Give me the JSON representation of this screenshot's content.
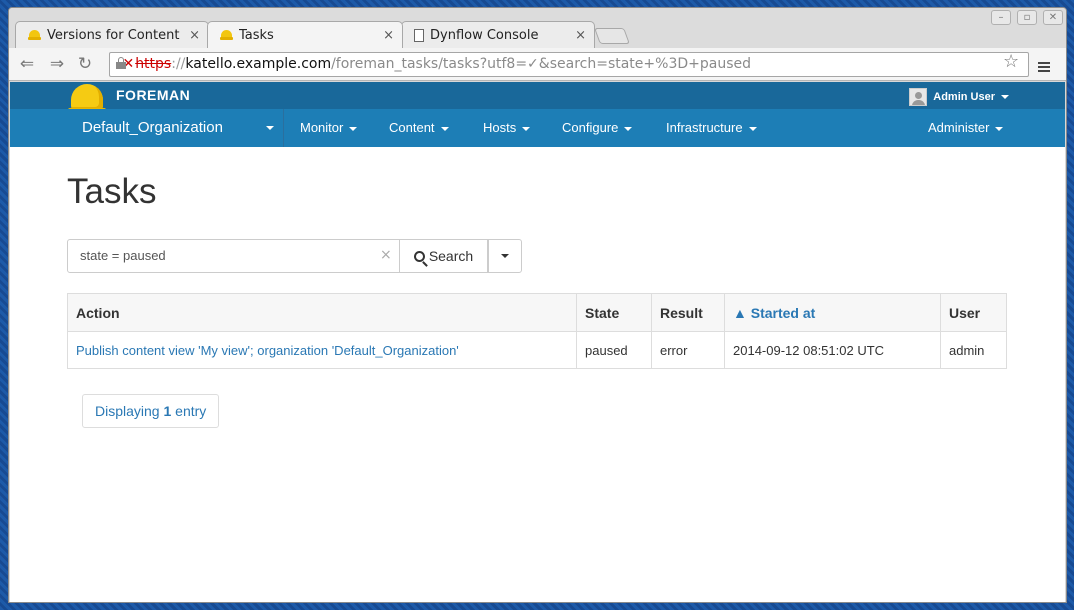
{
  "browser": {
    "tabs": [
      {
        "title": "Versions for Content V",
        "icon": "foreman-hat-icon"
      },
      {
        "title": "Tasks",
        "icon": "foreman-hat-icon"
      },
      {
        "title": "Dynflow Console",
        "icon": "page-icon"
      }
    ],
    "close_glyph": "×",
    "url": {
      "x_mark": "✕",
      "scheme": "https",
      "separator": "://",
      "host": "katello.example.com",
      "path": "/foreman_tasks/tasks?utf8=✓&search=state+%3D+paused"
    }
  },
  "header": {
    "brand": "FOREMAN",
    "user": "Admin User",
    "organization": "Default_Organization",
    "nav": {
      "monitor": "Monitor",
      "content": "Content",
      "hosts": "Hosts",
      "configure": "Configure",
      "infrastructure": "Infrastructure",
      "administer": "Administer"
    }
  },
  "main": {
    "title": "Tasks",
    "search": {
      "value": "state = paused",
      "clear": "×",
      "button": "Search"
    },
    "table": {
      "columns": {
        "action": "Action",
        "state": "State",
        "result": "Result",
        "started_at": "▲ Started at",
        "user": "User"
      },
      "rows": [
        {
          "action": "Publish content view 'My view'; organization 'Default_Organization'",
          "state": "paused",
          "result": "error",
          "started_at": "2014-09-12 08:51:02 UTC",
          "user": "admin"
        }
      ]
    },
    "pagination": {
      "prefix": "Displaying",
      "count": "1",
      "suffix": "entry"
    }
  }
}
